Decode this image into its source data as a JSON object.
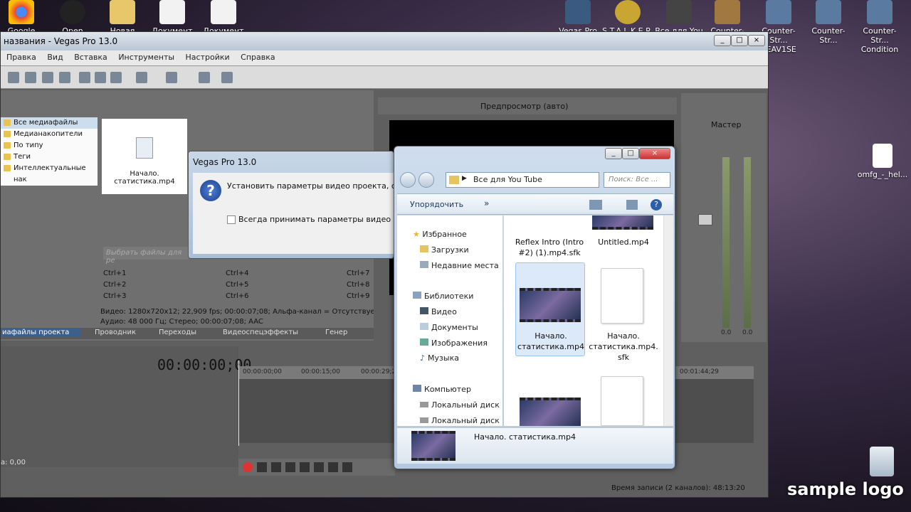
{
  "desktop_icons": [
    {
      "label": "Google"
    },
    {
      "label": "Open"
    },
    {
      "label": "Новая папка"
    },
    {
      "label": "Документ"
    },
    {
      "label": "Документ"
    },
    {
      "label": "Vegas Pro"
    },
    {
      "label": "S.T.A.L.K.E.R."
    },
    {
      "label": "Все для You"
    },
    {
      "label": "Counter-Str..."
    },
    {
      "label": "Counter-Str... BEAV1SE"
    },
    {
      "label": "Counter-Str..."
    },
    {
      "label": "Counter-Str... Condition"
    },
    {
      "label": "omfg_-_hel..."
    }
  ],
  "vegas": {
    "title": "названия - Vegas Pro 13.0",
    "menu": [
      "Правка",
      "Вид",
      "Вставка",
      "Инструменты",
      "Настройки",
      "Справка"
    ],
    "tree": [
      "Все медиафайлы",
      "Медианакопители",
      "По типу",
      "Теги",
      "Интеллектуальные нак"
    ],
    "media_file": "Начало. статистика.mp4",
    "search_placeholder": "Выбрать файлы для ре",
    "shortcuts": [
      "Ctrl+1",
      "Ctrl+4",
      "Ctrl+7",
      "Ctrl+2",
      "Ctrl+5",
      "Ctrl+8",
      "Ctrl+3",
      "Ctrl+6",
      "Ctrl+9"
    ],
    "video_info": "Видео: 1280x720x12; 22,909 fps; 00:00:07;08; Альфа-канал = Отсутствует; Пс",
    "audio_info": "Аудио: 48 000 Гц; Стерео; 00:00:07;08; AAC",
    "tabs": [
      "иафайлы проекта",
      "Проводник",
      "Переходы",
      "Видеоспецэффекты",
      "Генер"
    ],
    "preview_label": "Предпросмотр (авто)",
    "master_label": "Мастер",
    "timecode": "00:00:00;00",
    "ruler": [
      "00:00:00;00",
      "00:00:15;00",
      "00:00:29;2",
      "00:01:44;29"
    ],
    "rate": "а: 0,00",
    "record_time": "Время записи (2 каналов): 48:13:20",
    "meter_values": [
      "0.0",
      "0.0"
    ]
  },
  "dialog": {
    "title": "Vegas Pro 13.0",
    "message": "Установить параметры видео проекта, соответ",
    "checkbox": "Всегда принимать параметры видео проекта"
  },
  "explorer": {
    "address": "Все для You Tube",
    "search_placeholder": "Поиск: Все ...",
    "organize": "Упорядочить",
    "more": "»",
    "nav": {
      "favorites": "Избранное",
      "downloads": "Загрузки",
      "recent": "Недавние места",
      "libraries": "Библиотеки",
      "video": "Видео",
      "documents": "Документы",
      "images": "Изображения",
      "music": "Музыка",
      "computer": "Компьютер",
      "disk1": "Локальный диск",
      "disk2": "Локальный диск"
    },
    "files": [
      {
        "name": "Reflex Intro (Intro #2) (1).mp4.sfk"
      },
      {
        "name": "Untitled.mp4"
      },
      {
        "name": "Начало. статистика.mp4"
      },
      {
        "name": "Начало. статистика.mp4. sfk"
      }
    ],
    "details_name": "Начало. статистика.mp4"
  },
  "watermark": "sample logo"
}
